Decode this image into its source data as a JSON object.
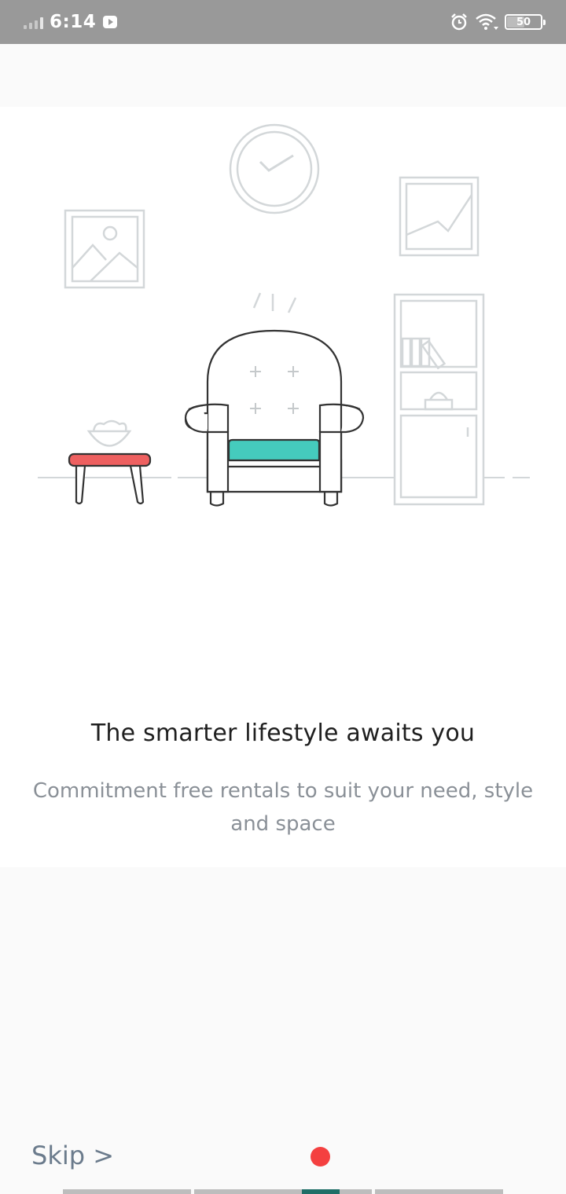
{
  "status_bar": {
    "time": "6:14",
    "battery_level": "50",
    "icons": [
      "signal-icon",
      "youtube-icon",
      "alarm-icon",
      "wifi-icon",
      "battery-icon"
    ]
  },
  "onboarding": {
    "title": "The smarter lifestyle awaits you",
    "subtitle_line1": "Commitment free rentals to suit your need, style",
    "subtitle_line2": "and space"
  },
  "footer": {
    "skip_label": "Skip >"
  },
  "colors": {
    "status_bar": "#999999",
    "accent_teal": "#45cbbd",
    "table_red": "#ee6060",
    "dot_red": "#f44040",
    "active_progress": "#1f6e67",
    "line_gray": "#d3d7d9"
  }
}
